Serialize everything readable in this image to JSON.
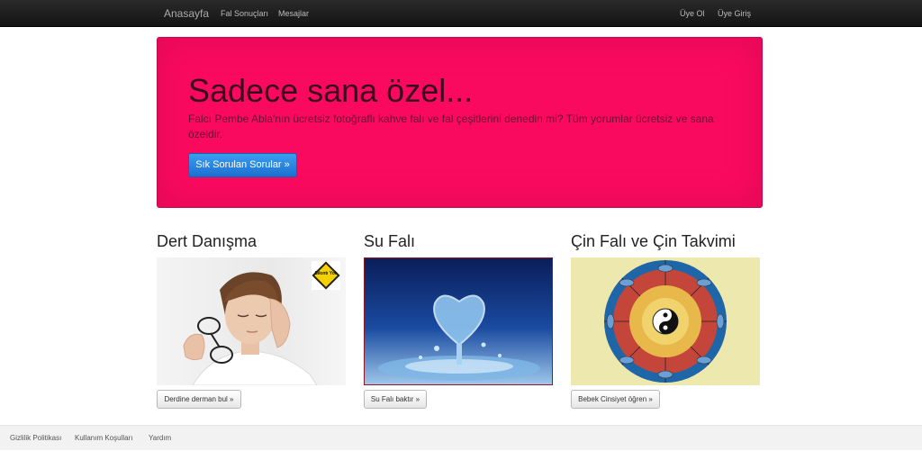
{
  "navbar": {
    "brand": "Anasayfa",
    "left_links": [
      "Fal Sonuçları",
      "Mesajlar"
    ],
    "right_links": [
      "Üye Ol",
      "Üye Giriş"
    ]
  },
  "hero": {
    "title": "Sadece sana özel...",
    "text": "Falcı Pembe Abla'nın ücretsiz fotoğraflı kahve falı ve fal çeşitlerini denedin mi? Tüm yorumlar ücretsiz ve sana özeldir.",
    "button_label": "Sık Sorulan Sorular »",
    "background_color": "#fa0a5f"
  },
  "cards": [
    {
      "title": "Dert Danışma",
      "button_label": "Derdine derman bul »",
      "image": "woman-headache-photo",
      "sticker_text": "Sıkıntı Yok"
    },
    {
      "title": "Su Falı",
      "button_label": "Su Falı baktır »",
      "image": "water-heart-splash-photo"
    },
    {
      "title": "Çin Falı ve Çin Takvimi",
      "button_label": "Bebek Cinsiyet öğren »",
      "image": "chinese-zodiac-wheel"
    }
  ],
  "footer": {
    "links": [
      "Gizlilik Politikası",
      "Kullanım Koşulları",
      "Yardım"
    ]
  }
}
